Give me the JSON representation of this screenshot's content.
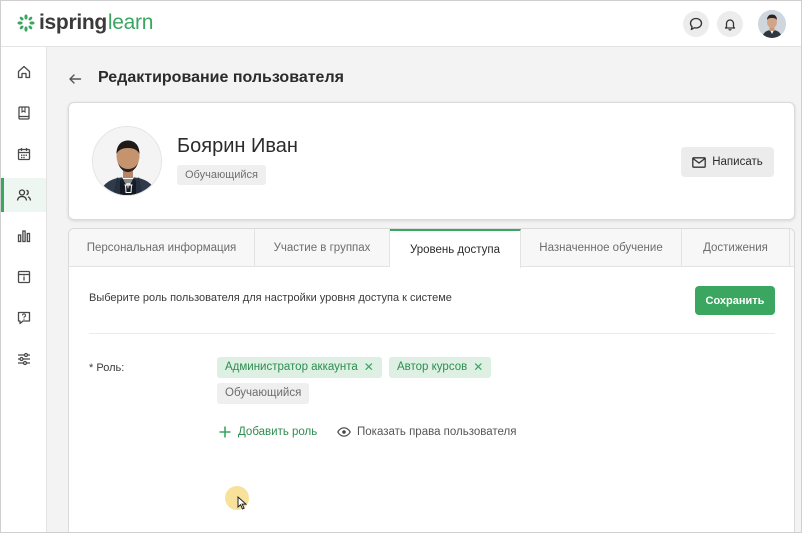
{
  "app": {
    "logo_main": "ispring",
    "logo_accent": "learn",
    "accent_color": "#3aa660"
  },
  "topbar": {
    "icons": [
      "chat-icon",
      "bell-icon",
      "user-avatar"
    ]
  },
  "sidebar": {
    "items": [
      {
        "icon": "home-icon",
        "active": false
      },
      {
        "icon": "book-icon",
        "active": false
      },
      {
        "icon": "calendar-icon",
        "active": false
      },
      {
        "icon": "users-icon",
        "active": true
      },
      {
        "icon": "chart-icon",
        "active": false
      },
      {
        "icon": "info-icon",
        "active": false
      },
      {
        "icon": "question-icon",
        "active": false
      },
      {
        "icon": "settings-sliders-icon",
        "active": false
      }
    ]
  },
  "page": {
    "title": "Редактирование пользователя"
  },
  "profile": {
    "name": "Боярин Иван",
    "role_badge": "Обучающийся",
    "write_button": "Написать"
  },
  "tabs": [
    {
      "label": "Персональная информация",
      "active": false
    },
    {
      "label": "Участие в группах",
      "active": false
    },
    {
      "label": "Уровень доступа",
      "active": true
    },
    {
      "label": "Назначенное обучение",
      "active": false
    },
    {
      "label": "Достижения",
      "active": false
    }
  ],
  "access": {
    "description": "Выберите роль пользователя для настройки уровня доступа к системе",
    "save_button": "Сохранить",
    "role_label": "* Роль:",
    "roles": [
      {
        "label": "Администратор аккаунта",
        "removable": true
      },
      {
        "label": "Автор курсов",
        "removable": true
      },
      {
        "label": "Обучающийся",
        "removable": false
      }
    ],
    "remove_symbol": "✕",
    "add_role": "Добавить роль",
    "show_rights": "Показать права пользователя"
  }
}
